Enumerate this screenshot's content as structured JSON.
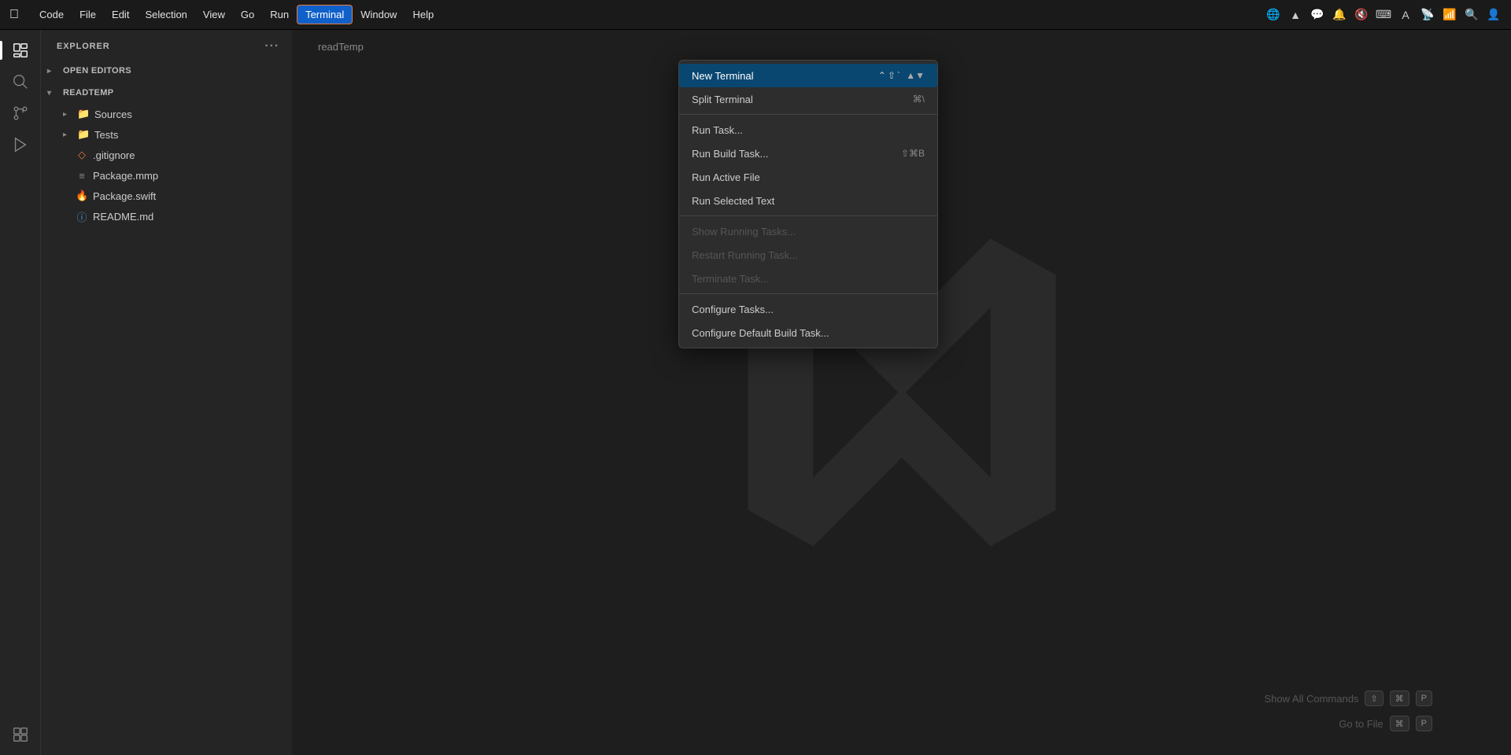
{
  "menubar": {
    "apple": "🍎",
    "items": [
      {
        "label": "Code",
        "active": false
      },
      {
        "label": "File",
        "active": false
      },
      {
        "label": "Edit",
        "active": false
      },
      {
        "label": "Selection",
        "active": false
      },
      {
        "label": "View",
        "active": false
      },
      {
        "label": "Go",
        "active": false
      },
      {
        "label": "Run",
        "active": false
      },
      {
        "label": "Terminal",
        "active": true
      },
      {
        "label": "Window",
        "active": false
      },
      {
        "label": "Help",
        "active": false
      }
    ]
  },
  "sidebar": {
    "explorer_label": "EXPLORER",
    "open_editors_label": "OPEN EDITORS",
    "readtemp_label": "READTEMP",
    "tree_items": [
      {
        "name": "Sources",
        "type": "folder",
        "indent": 1
      },
      {
        "name": "Tests",
        "type": "folder",
        "indent": 1
      },
      {
        "name": ".gitignore",
        "type": "gitignore",
        "indent": 1
      },
      {
        "name": "Package.mmp",
        "type": "mmp",
        "indent": 1
      },
      {
        "name": "Package.swift",
        "type": "swift",
        "indent": 1
      },
      {
        "name": "README.md",
        "type": "info",
        "indent": 1
      }
    ]
  },
  "editor": {
    "title": "readTemp"
  },
  "terminal_menu": {
    "items": [
      {
        "label": "New Terminal",
        "shortcut": "⌃⇧`",
        "highlighted": true,
        "disabled": false
      },
      {
        "label": "Split Terminal",
        "shortcut": "⌘\\",
        "highlighted": false,
        "disabled": false
      },
      {
        "divider": true
      },
      {
        "label": "Run Task...",
        "shortcut": "",
        "highlighted": false,
        "disabled": false
      },
      {
        "label": "Run Build Task...",
        "shortcut": "⇧⌘B",
        "highlighted": false,
        "disabled": false
      },
      {
        "label": "Run Active File",
        "shortcut": "",
        "highlighted": false,
        "disabled": false
      },
      {
        "label": "Run Selected Text",
        "shortcut": "",
        "highlighted": false,
        "disabled": false
      },
      {
        "divider": true
      },
      {
        "label": "Show Running Tasks...",
        "shortcut": "",
        "highlighted": false,
        "disabled": true
      },
      {
        "label": "Restart Running Task...",
        "shortcut": "",
        "highlighted": false,
        "disabled": true
      },
      {
        "label": "Terminate Task...",
        "shortcut": "",
        "highlighted": false,
        "disabled": true
      },
      {
        "divider": true
      },
      {
        "label": "Configure Tasks...",
        "shortcut": "",
        "highlighted": false,
        "disabled": false
      },
      {
        "label": "Configure Default Build Task...",
        "shortcut": "",
        "highlighted": false,
        "disabled": false
      }
    ]
  },
  "bottom_hints": [
    {
      "label": "Show All Commands",
      "keys": [
        "⇧",
        "⌘",
        "P"
      ]
    },
    {
      "label": "Go to File",
      "keys": [
        "⌘",
        "P"
      ]
    }
  ],
  "activity_icons": [
    {
      "name": "files",
      "symbol": "⧉",
      "active": true
    },
    {
      "name": "search",
      "symbol": "🔍",
      "active": false
    },
    {
      "name": "source-control",
      "symbol": "⑂",
      "active": false
    },
    {
      "name": "run-debug",
      "symbol": "▷",
      "active": false
    },
    {
      "name": "extensions",
      "symbol": "⊞",
      "active": false
    }
  ],
  "colors": {
    "accent": "#094771",
    "highlighted_bg": "#094771",
    "menu_bg": "#2d2d2d",
    "sidebar_bg": "#252526",
    "editor_bg": "#1e1e1e",
    "menubar_bg": "#1a1a1a"
  }
}
